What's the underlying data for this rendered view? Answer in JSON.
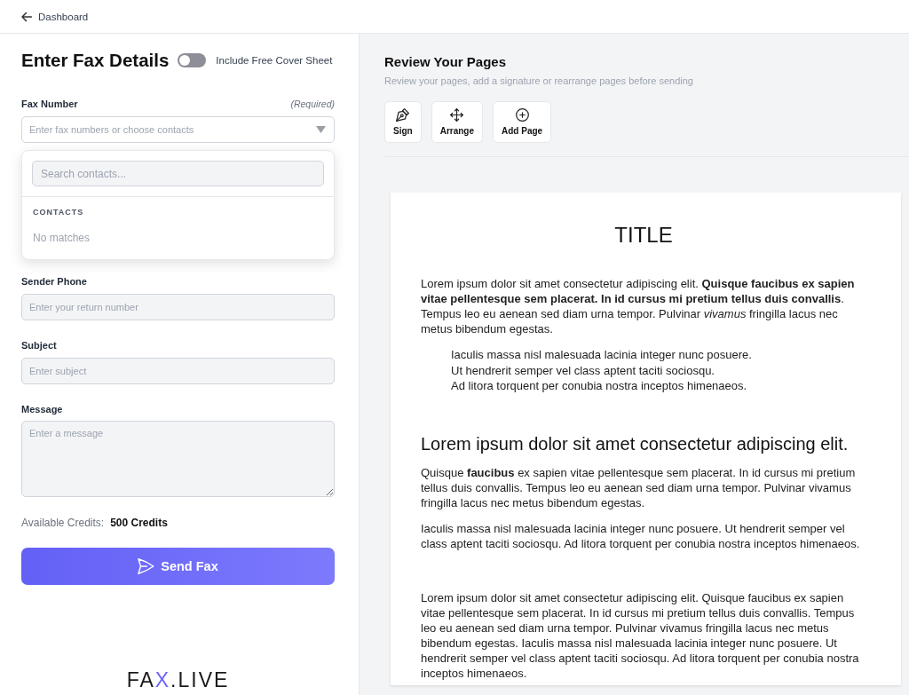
{
  "top_bar": {
    "back_link": "Dashboard"
  },
  "form": {
    "title": "Enter Fax Details",
    "cover_sheet": {
      "label": "Include Free Cover Sheet",
      "on": false
    },
    "fax_number": {
      "label": "Fax Number",
      "note": "(Required)",
      "placeholder": "Enter fax numbers or choose contacts",
      "expanded": true,
      "dropdown": {
        "search_placeholder": "Search contacts...",
        "section": "CONTACTS",
        "empty_text": "No matches"
      }
    },
    "fields": [
      {
        "kind": "input",
        "label": "Sender Phone",
        "placeholder": "Enter your return number"
      },
      {
        "kind": "input",
        "label": "Subject",
        "placeholder": "Enter subject"
      },
      {
        "kind": "textarea",
        "label": "Message",
        "placeholder": "Enter a message"
      }
    ],
    "credits": {
      "label": "Available Credits:",
      "value": "500 Credits"
    },
    "send_button": "Send Fax",
    "logo": [
      {
        "text": "FA",
        "accent": false
      },
      {
        "text": "X",
        "accent": true
      },
      {
        "text": ".LIVE",
        "accent": false
      }
    ]
  },
  "review": {
    "title": "Review Your Pages",
    "subtitle": "Review your pages, add a signature or rearrange pages before sending",
    "tools": [
      {
        "kind": "sign",
        "label": "Sign"
      },
      {
        "kind": "arrange",
        "label": "Arrange"
      },
      {
        "kind": "add",
        "label": "Add Page"
      }
    ],
    "document": {
      "sections": [
        {
          "blocks": [
            {
              "kind": "title",
              "text": "TITLE"
            },
            {
              "kind": "paragraph",
              "text": "Lorem ipsum dolor sit amet consectetur adipiscing elit. **Quisque faucibus ex sapien vitae pellentesque sem placerat. In id cursus mi pretium tellus duis convallis**. Tempus leo eu aenean sed diam urna tempor. Pulvinar *vivamus* fringilla lacus nec metus bibendum egestas."
            },
            {
              "kind": "indented",
              "lines": [
                "Iaculis massa nisl malesuada lacinia integer nunc posuere.",
                "Ut hendrerit semper vel class aptent taciti sociosqu.",
                "Ad litora torquent per conubia nostra inceptos himenaeos."
              ]
            }
          ]
        },
        {
          "blocks": [
            {
              "kind": "heading",
              "text": "Lorem ipsum dolor sit amet consectetur adipiscing elit."
            },
            {
              "kind": "paragraph",
              "text": "Quisque **faucibus** ex sapien vitae pellentesque sem placerat. In id cursus mi pretium tellus duis convallis. Tempus leo eu aenean sed diam urna tempor. Pulvinar vivamus fringilla lacus nec metus bibendum egestas."
            },
            {
              "kind": "paragraph",
              "text": "Iaculis massa nisl malesuada lacinia integer nunc posuere. Ut hendrerit semper vel class aptent taciti sociosqu. Ad litora torquent per conubia nostra inceptos himenaeos."
            }
          ]
        },
        {
          "blocks": [
            {
              "kind": "paragraph",
              "text": "Lorem ipsum dolor sit amet consectetur adipiscing elit. Quisque faucibus ex sapien vitae pellentesque sem placerat. In id cursus mi pretium tellus duis convallis. Tempus leo eu aenean sed diam urna tempor. Pulvinar vivamus fringilla lacus nec metus bibendum egestas. Iaculis massa nisl malesuada lacinia integer nunc posuere. Ut hendrerit semper vel class aptent taciti sociosqu. Ad litora torquent per conubia nostra inceptos himenaeos."
            }
          ]
        }
      ]
    }
  }
}
